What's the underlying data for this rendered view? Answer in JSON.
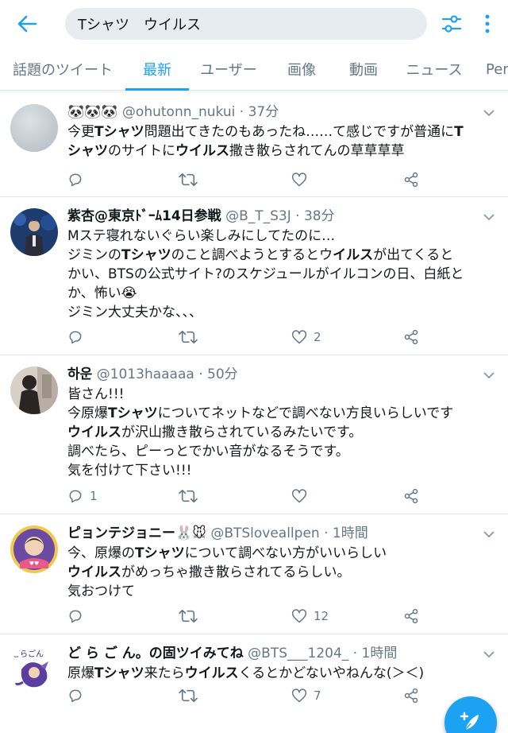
{
  "search": {
    "query": "Tシャツ　ウイルス"
  },
  "tabs": [
    {
      "label": "話題のツイート"
    },
    {
      "label": "最新"
    },
    {
      "label": "ユーザー"
    },
    {
      "label": "画像"
    },
    {
      "label": "動画"
    },
    {
      "label": "ニュース"
    },
    {
      "label": "Per"
    }
  ],
  "colors": {
    "accent": "#1da1f2",
    "secondary_text": "#657786",
    "divider": "#e1e8ed"
  },
  "icons": {
    "back": "arrow-left-icon",
    "filter": "sliders-icon",
    "more": "more-vertical-icon",
    "reply": "reply-icon",
    "retweet": "retweet-icon",
    "like": "heart-icon",
    "share": "share-icon",
    "caret": "chevron-down-icon",
    "compose": "feather-plus-icon"
  },
  "tweets": [
    {
      "name": "🐼🐼🐼",
      "handle": "@ohutonn_nukui",
      "sep": " · ",
      "time": "37分",
      "lines": [
        [
          {
            "t": "今更"
          },
          {
            "t": "Tシャツ",
            "b": true
          },
          {
            "t": "問題出てきたのもあったね……て感じですが普通に"
          },
          {
            "t": "T",
            "b": true
          }
        ],
        [
          {
            "t": "シャツ",
            "b": true
          },
          {
            "t": "のサイトに"
          },
          {
            "t": "ウイルス",
            "b": true
          },
          {
            "t": "撒き散らされてんの草草草草"
          }
        ]
      ],
      "reply_count": "",
      "retweet_count": "",
      "like_count": ""
    },
    {
      "name": "紫杏@東京ﾄﾞｰﾑ14日参戦",
      "handle": "@B_T_S3J",
      "sep": " · ",
      "time": "38分",
      "lines": [
        [
          {
            "t": "Mステ寝れないぐらい楽しみにしてたのに…"
          }
        ],
        [
          {
            "t": "ジミンの"
          },
          {
            "t": "Tシャツ",
            "b": true
          },
          {
            "t": "のこと調べようとするとウ"
          },
          {
            "t": "イルス",
            "b": true
          },
          {
            "t": "が出てくると"
          }
        ],
        [
          {
            "t": "かい、BTSの公式サイト?のスケジュールがイルコンの日、白紙と"
          }
        ],
        [
          {
            "t": "か、怖い😭"
          }
        ],
        [
          {
            "t": "ジミン大丈夫かな、、、"
          }
        ]
      ],
      "reply_count": "",
      "retweet_count": "",
      "like_count": "2"
    },
    {
      "name": "하운",
      "handle": "@1013haaaaa",
      "sep": " · ",
      "time": "50分",
      "lines": [
        [
          {
            "t": "皆さん!!!"
          }
        ],
        [
          {
            "t": "今原爆"
          },
          {
            "t": "Tシャツ",
            "b": true
          },
          {
            "t": "についてネットなどで調べない方良いらしいです"
          }
        ],
        [
          {
            "t": "ウイルス",
            "b": true
          },
          {
            "t": "が沢山撒き散らされているみたいです。"
          }
        ],
        [
          {
            "t": "調べたら、ピーっとでかい音がなるそうです。"
          }
        ],
        [
          {
            "t": "気を付けて下さい!!!"
          }
        ]
      ],
      "reply_count": "1",
      "retweet_count": "",
      "like_count": ""
    },
    {
      "name": "ピョンテジョニー🐰🐭",
      "handle": "@BTSloveallpen",
      "sep": " · ",
      "time": "1時間",
      "lines": [
        [
          {
            "t": "今、原爆の"
          },
          {
            "t": "Tシャツ",
            "b": true
          },
          {
            "t": "について調べない方がいいらしい"
          }
        ],
        [
          {
            "t": "ウイルス",
            "b": true
          },
          {
            "t": "がめっちゃ撒き散らされてるらしい。"
          }
        ],
        [
          {
            "t": "気おつけて"
          }
        ]
      ],
      "reply_count": "",
      "retweet_count": "",
      "like_count": "12"
    },
    {
      "name": "ど ら ご ん。の固ツイみてね",
      "handle": "@BTS___1204_",
      "sep": " · ",
      "time": "1時間",
      "lines": [
        [
          {
            "t": "原爆"
          },
          {
            "t": "Tシャツ",
            "b": true
          },
          {
            "t": "来たら"
          },
          {
            "t": "ウイルス",
            "b": true
          },
          {
            "t": "くるとかどないやねんな(＞＜)"
          }
        ]
      ],
      "reply_count": "",
      "retweet_count": "",
      "like_count": "7"
    }
  ]
}
